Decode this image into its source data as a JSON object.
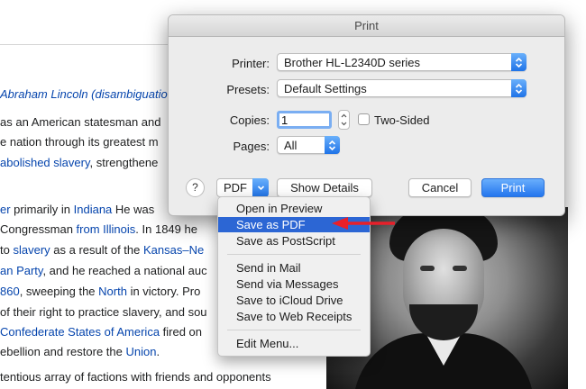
{
  "article": {
    "lines": [
      {
        "pre": "",
        "link": "",
        "italic": "Abraham Lincoln (disambiguation",
        "post": ""
      },
      {
        "pre": "as an American statesman and",
        "link": "",
        "italic": "",
        "post": ""
      },
      {
        "pre": "e nation through its greatest m",
        "link": "",
        "italic": "",
        "post": ""
      },
      {
        "pre": "",
        "link": "abolished slavery",
        "italic": "",
        "post": ", strengthene"
      },
      {
        "pre": "",
        "link": "er",
        "italic": "",
        "post": " primarily in "
      },
      {
        "pre": "Congressman ",
        "link": "from Illinois",
        "italic": "",
        "post": ". In 1849 he"
      },
      {
        "pre": "to ",
        "link": "slavery",
        "italic": "",
        "post": " as a result of the "
      },
      {
        "pre": "",
        "link": "an Party",
        "italic": "",
        "post": ", and he reached a national auc"
      },
      {
        "pre": "",
        "link": "860",
        "italic": "",
        "post": ", sweeping the "
      },
      {
        "pre": "of their right to practice slavery, and sou",
        "link": "",
        "italic": "",
        "post": ""
      },
      {
        "pre": "",
        "link": "Confederate States of America",
        "italic": "",
        "post": " fired on"
      },
      {
        "pre": "ebellion and restore the ",
        "link": "Union",
        "italic": "",
        "post": "."
      },
      {
        "pre": "tentious array of factions with friends and opponents",
        "link": "",
        "italic": "",
        "post": ""
      }
    ],
    "extra_links": {
      "indiana": "Indiana",
      "he_was": " He was",
      "kansas": "Kansas–Ne",
      "north": "North",
      "in_victory": " in victory. Pro"
    }
  },
  "dialog": {
    "title": "Print",
    "printer_label": "Printer:",
    "printer_value": "Brother HL-L2340D series",
    "presets_label": "Presets:",
    "presets_value": "Default Settings",
    "copies_label": "Copies:",
    "copies_value": "1",
    "two_sided_label": "Two-Sided",
    "pages_label": "Pages:",
    "pages_value": "All",
    "help_label": "?",
    "pdf_label": "PDF",
    "show_details_label": "Show Details",
    "cancel_label": "Cancel",
    "print_label": "Print"
  },
  "pdf_menu": {
    "items": [
      "Open in Preview",
      "Save as PDF",
      "Save as PostScript",
      "Send in Mail",
      "Send via Messages",
      "Save to iCloud Drive",
      "Save to Web Receipts",
      "Edit Menu..."
    ],
    "selected": "Save as PDF"
  },
  "colors": {
    "accent": "#2c66d4",
    "arrow": "#e8202a",
    "link": "#0645ad"
  }
}
